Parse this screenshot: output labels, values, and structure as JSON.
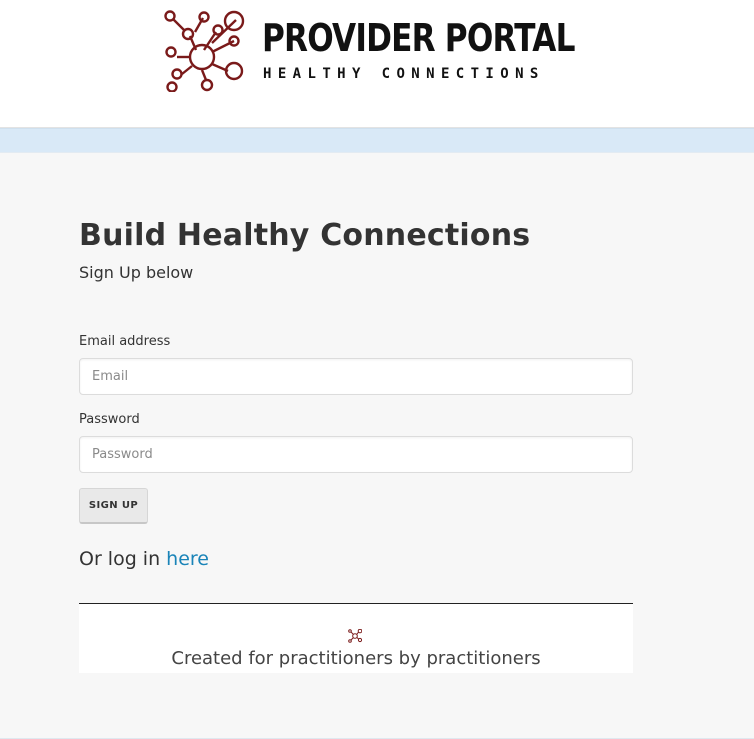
{
  "brand": {
    "title": "PROVIDER PORTAL",
    "tagline": "HEALTHY CONNECTIONS",
    "logo_icon": "network-nodes-icon",
    "accent_color": "#7a1a1a"
  },
  "signup": {
    "heading": "Build Healthy Connections",
    "subheading": "Sign Up below",
    "email_label": "Email address",
    "email_placeholder": "Email",
    "email_value": "",
    "password_label": "Password",
    "password_placeholder": "Password",
    "password_value": "",
    "submit_label": "SIGN UP",
    "login_prefix": "Or log in ",
    "login_link": "here"
  },
  "footer": {
    "icon": "network-nodes-icon",
    "text": "Created for practitioners by practitioners"
  },
  "colors": {
    "link": "#1a84b8",
    "strip": "#d9e9f7",
    "background": "#f7f7f7"
  }
}
